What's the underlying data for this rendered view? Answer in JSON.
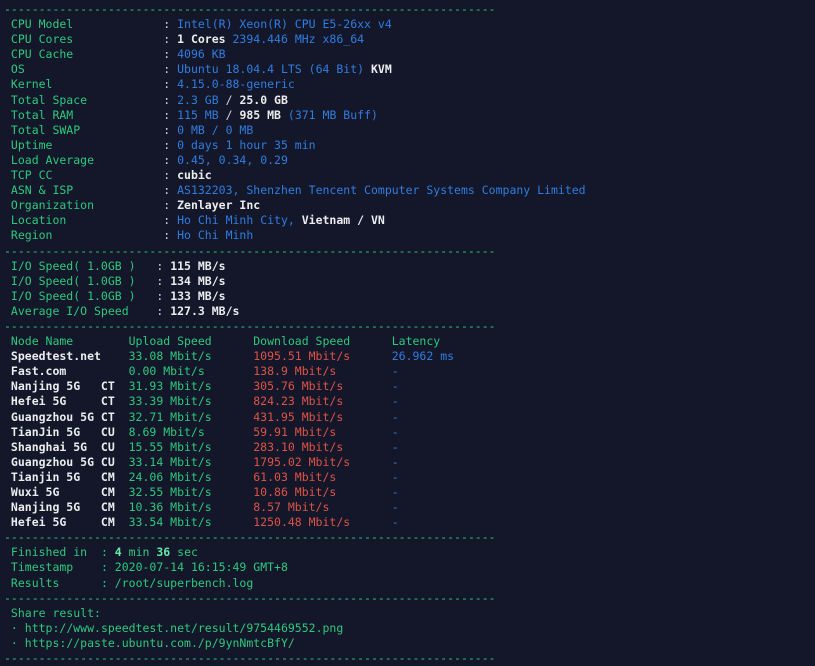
{
  "colors": {
    "background": "#141729",
    "green": "#2bc97e",
    "green_bright": "#64e8ab",
    "blue": "#2f7de0",
    "white": "#cfd3dd",
    "white_bold": "#ebecee",
    "red": "#dd5348"
  },
  "separator": "-----------------------------------------------------------------------",
  "sysinfo": {
    "rows": [
      {
        "label": "CPU Model",
        "value": [
          {
            "c": "blue",
            "t": "Intel(R) Xeon(R) CPU E5-26xx v4"
          }
        ]
      },
      {
        "label": "CPU Cores",
        "value": [
          {
            "c": "white_bold",
            "t": "1 Cores"
          },
          {
            "c": "blue",
            "t": " 2394.446 MHz x86_64"
          }
        ]
      },
      {
        "label": "CPU Cache",
        "value": [
          {
            "c": "blue",
            "t": "4096 KB"
          }
        ]
      },
      {
        "label": "OS",
        "value": [
          {
            "c": "blue",
            "t": "Ubuntu 18.04.4 LTS (64 Bit) "
          },
          {
            "c": "white_bold",
            "t": "KVM"
          }
        ]
      },
      {
        "label": "Kernel",
        "value": [
          {
            "c": "blue",
            "t": "4.15.0-88-generic"
          }
        ]
      },
      {
        "label": "Total Space",
        "value": [
          {
            "c": "blue",
            "t": "2.3 GB"
          },
          {
            "c": "white",
            "t": " / "
          },
          {
            "c": "white_bold",
            "t": "25.0 GB"
          }
        ]
      },
      {
        "label": "Total RAM",
        "value": [
          {
            "c": "blue",
            "t": "115 MB"
          },
          {
            "c": "white",
            "t": " / "
          },
          {
            "c": "white_bold",
            "t": "985 MB"
          },
          {
            "c": "blue",
            "t": " (371 MB Buff)"
          }
        ]
      },
      {
        "label": "Total SWAP",
        "value": [
          {
            "c": "blue",
            "t": "0 MB / 0 MB"
          }
        ]
      },
      {
        "label": "Uptime",
        "value": [
          {
            "c": "blue",
            "t": "0 days 1 hour 35 min"
          }
        ]
      },
      {
        "label": "Load Average",
        "value": [
          {
            "c": "blue",
            "t": "0.45, 0.34, 0.29"
          }
        ]
      },
      {
        "label": "TCP CC",
        "value": [
          {
            "c": "white_bold",
            "t": "cubic"
          }
        ]
      },
      {
        "label": "ASN & ISP",
        "value": [
          {
            "c": "blue",
            "t": "AS132203, Shenzhen Tencent Computer Systems Company Limited"
          }
        ]
      },
      {
        "label": "Organization",
        "value": [
          {
            "c": "white_bold",
            "t": "Zenlayer Inc"
          }
        ]
      },
      {
        "label": "Location",
        "value": [
          {
            "c": "blue",
            "t": "Ho Chi Minh City, "
          },
          {
            "c": "white_bold",
            "t": "Vietnam / VN"
          }
        ]
      },
      {
        "label": "Region",
        "value": [
          {
            "c": "blue",
            "t": "Ho Chi Minh"
          }
        ]
      }
    ]
  },
  "io": {
    "rows": [
      {
        "label": "I/O Speed( 1.0GB )",
        "value": "115 MB/s"
      },
      {
        "label": "I/O Speed( 1.0GB )",
        "value": "134 MB/s"
      },
      {
        "label": "I/O Speed( 1.0GB )",
        "value": "133 MB/s"
      },
      {
        "label": "Average I/O Speed",
        "value": "127.3 MB/s"
      }
    ]
  },
  "speedtest": {
    "headers": [
      "Node Name",
      "Upload Speed",
      "Download Speed",
      "Latency"
    ],
    "rows": [
      {
        "name": "Speedtest.net",
        "code": "",
        "upload": "33.08 Mbit/s",
        "download": "1095.51 Mbit/s",
        "latency": "26.962 ms"
      },
      {
        "name": "Fast.com",
        "code": "",
        "upload": "0.00 Mbit/s",
        "download": "138.9 Mbit/s",
        "latency": "-"
      },
      {
        "name": "Nanjing 5G",
        "code": "CT",
        "upload": "31.93 Mbit/s",
        "download": "305.76 Mbit/s",
        "latency": "-"
      },
      {
        "name": "Hefei 5G",
        "code": "CT",
        "upload": "33.39 Mbit/s",
        "download": "824.23 Mbit/s",
        "latency": "-"
      },
      {
        "name": "Guangzhou 5G",
        "code": "CT",
        "upload": "32.71 Mbit/s",
        "download": "431.95 Mbit/s",
        "latency": "-"
      },
      {
        "name": "TianJin 5G",
        "code": "CU",
        "upload": "8.69 Mbit/s",
        "download": "59.91 Mbit/s",
        "latency": "-"
      },
      {
        "name": "Shanghai 5G",
        "code": "CU",
        "upload": "15.55 Mbit/s",
        "download": "283.10 Mbit/s",
        "latency": "-"
      },
      {
        "name": "Guangzhou 5G",
        "code": "CU",
        "upload": "33.14 Mbit/s",
        "download": "1795.02 Mbit/s",
        "latency": "-"
      },
      {
        "name": "Tianjin 5G",
        "code": "CM",
        "upload": "24.06 Mbit/s",
        "download": "61.03 Mbit/s",
        "latency": "-"
      },
      {
        "name": "Wuxi 5G",
        "code": "CM",
        "upload": "32.55 Mbit/s",
        "download": "10.86 Mbit/s",
        "latency": "-"
      },
      {
        "name": "Nanjing 5G",
        "code": "CM",
        "upload": "10.36 Mbit/s",
        "download": "8.57 Mbit/s",
        "latency": "-"
      },
      {
        "name": "Hefei 5G",
        "code": "CM",
        "upload": "33.54 Mbit/s",
        "download": "1250.48 Mbit/s",
        "latency": "-"
      }
    ]
  },
  "summary": {
    "rows": [
      {
        "label": "Finished in",
        "segments": [
          {
            "c": "green_bright",
            "t": "4"
          },
          {
            "c": "green",
            "t": " min "
          },
          {
            "c": "green_bright",
            "t": "36"
          },
          {
            "c": "green",
            "t": " sec"
          }
        ]
      },
      {
        "label": "Timestamp",
        "segments": [
          {
            "c": "green",
            "t": "2020-07-14 16:15:49 GMT+8"
          }
        ]
      },
      {
        "label": "Results",
        "segments": [
          {
            "c": "green",
            "t": "/root/superbench.log"
          }
        ]
      }
    ]
  },
  "share": {
    "title": "Share result:",
    "bullet": "·",
    "links": [
      "http://www.speedtest.net/result/9754469552.png",
      "https://paste.ubuntu.com./p/9ynNmtcBfY/"
    ]
  }
}
